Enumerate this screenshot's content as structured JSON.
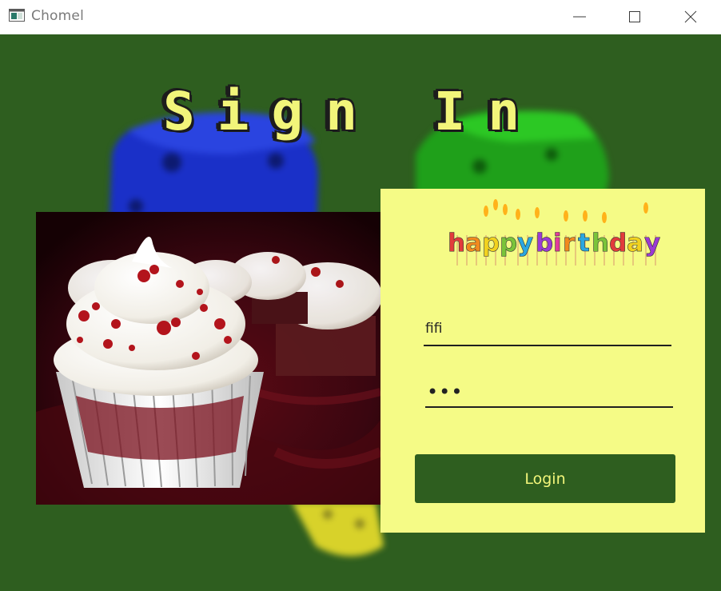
{
  "window": {
    "title": "Chomel",
    "icon": "app-window-icon"
  },
  "controls": {
    "minimize_icon": "minimize-icon",
    "maximize_icon": "maximize-icon",
    "close_icon": "close-icon"
  },
  "page": {
    "heading": "Sign In",
    "background_color": "#2e5e1f",
    "accent_color": "#f5fb86"
  },
  "banner": {
    "text": "happybirthday"
  },
  "form": {
    "username_value": "fifi",
    "password_masked": "•••",
    "login_label": "Login"
  }
}
